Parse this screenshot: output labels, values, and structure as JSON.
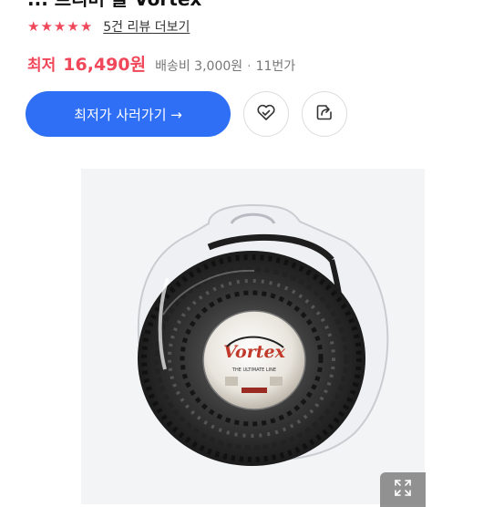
{
  "product": {
    "title_partial": "... 트리머 줄 Vortex"
  },
  "rating": {
    "stars": 5,
    "star_icon": "★",
    "review_link": "5건 리뷰 더보기"
  },
  "price": {
    "prefix": "최저",
    "value": "16,490원",
    "shipping": "배송비 3,000원",
    "separator": "·",
    "seller": "11번가"
  },
  "actions": {
    "buy_label": "최저가 사러가기 →"
  },
  "photo": {
    "label_brand": "Vortex",
    "label_sub": "THE ULTIMATE LINE"
  },
  "colors": {
    "accent_red": "#f0485a",
    "primary_blue": "#2f6ff5"
  }
}
